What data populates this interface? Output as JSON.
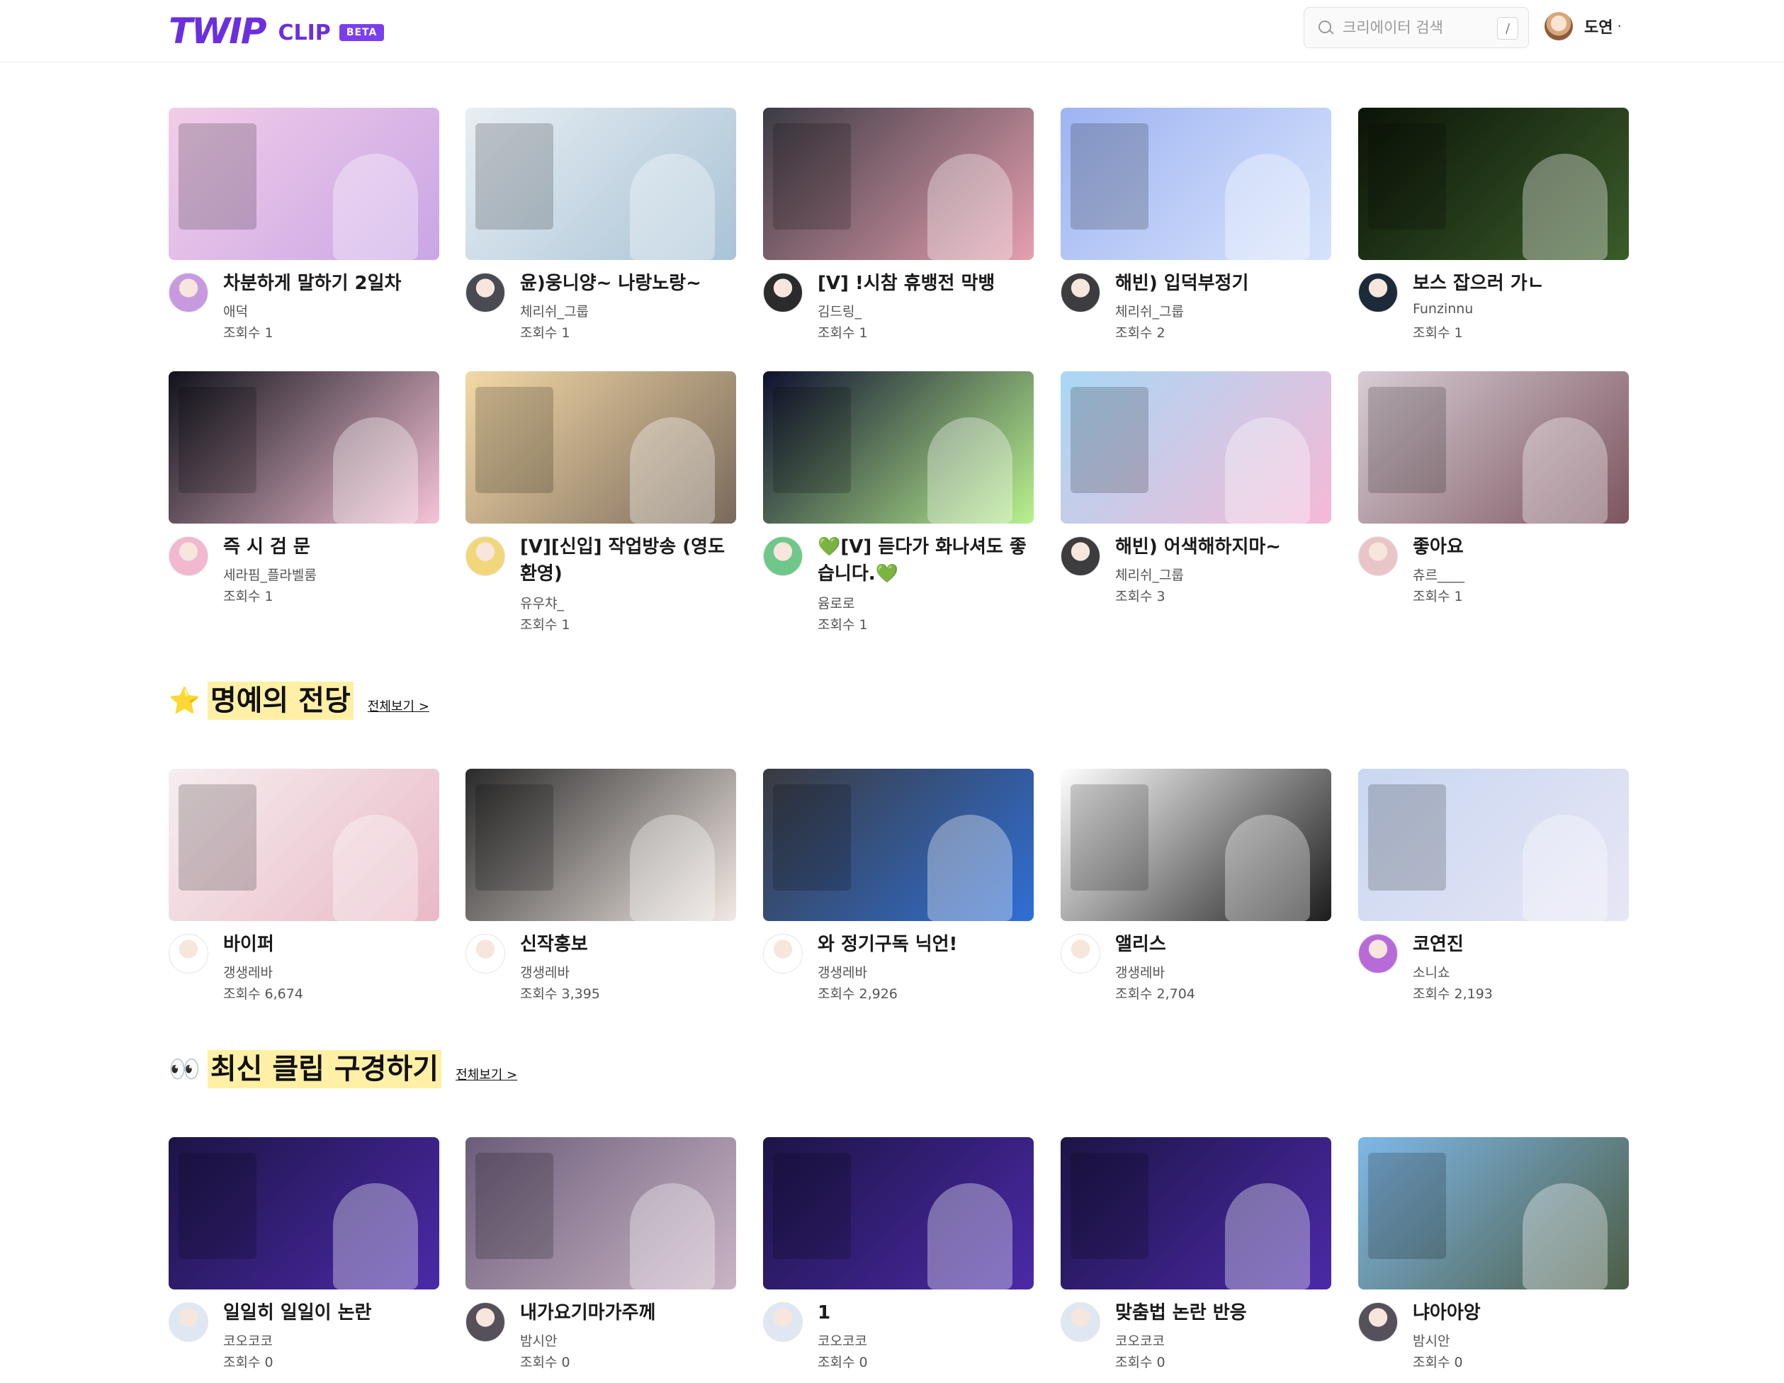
{
  "header": {
    "logo_main": "TWIP",
    "logo_sub": "CLIP",
    "logo_badge": "BETA",
    "search_placeholder": "크리에이터 검색",
    "search_shortcut": "/",
    "user_name": "도연",
    "user_caret": "·",
    "brand_color": "#6b2fe0"
  },
  "top_clips": [
    {
      "title": "차분하게 말하기 2일차",
      "channel": "애덕",
      "views": "조회수 1",
      "thumb_colors": [
        "#f2cde8",
        "#c9a6e6"
      ],
      "avatar_color": "#c79ae0"
    },
    {
      "title": "윤)웅니양~ 나랑노랑~",
      "channel": "체리쉬_그룹",
      "views": "조회수 1",
      "thumb_colors": [
        "#e8eef3",
        "#a9c3d6"
      ],
      "avatar_color": "#4a4a52"
    },
    {
      "title": "[V] !시참 휴뱅전 막뱅",
      "channel": "김드링_",
      "views": "조회수 1",
      "thumb_colors": [
        "#3c3b44",
        "#e69fb0"
      ],
      "avatar_color": "#2b2b2b"
    },
    {
      "title": "해빈) 입덕부정기",
      "channel": "체리쉬_그룹",
      "views": "조회수 2",
      "thumb_colors": [
        "#9eb4f2",
        "#d7e3fb"
      ],
      "avatar_color": "#3d3d40"
    },
    {
      "title": "보스 잡으러 가ㄴ",
      "channel": "Funzinnu",
      "views": "조회수 1",
      "thumb_colors": [
        "#0b1408",
        "#3b5c2a"
      ],
      "avatar_color": "#1c2a3a"
    },
    {
      "title": "즉 시 검 문",
      "channel": "세라핌_플라벨룸",
      "views": "조회수 1",
      "thumb_colors": [
        "#10121a",
        "#f7c4d8"
      ],
      "avatar_color": "#f2b8cf"
    },
    {
      "title": "[V][신입] 작업방송 (영도환영)",
      "channel": "유우챠_",
      "views": "조회수 1",
      "thumb_colors": [
        "#f3d9a6",
        "#7a6a5c"
      ],
      "avatar_color": "#f2d77a"
    },
    {
      "title": "💚[V] 듣다가 화나셔도 좋습니다.💚",
      "channel": "윰로로",
      "views": "조회수 1",
      "thumb_colors": [
        "#0f1030",
        "#b9f28f"
      ],
      "avatar_color": "#6fc88a"
    },
    {
      "title": "해빈) 어색해하지마~",
      "channel": "체리쉬_그룹",
      "views": "조회수 3",
      "thumb_colors": [
        "#a8d8f5",
        "#f6b9d6"
      ],
      "avatar_color": "#3d3d40"
    },
    {
      "title": "좋아요",
      "channel": "츄르____",
      "views": "조회수 1",
      "thumb_colors": [
        "#d8cdd4",
        "#7c5560"
      ],
      "avatar_color": "#e9c4c8"
    }
  ],
  "hall_of_fame": {
    "emoji": "⭐",
    "title": "명예의 전당",
    "more": "전체보기 >",
    "clips": [
      {
        "title": "바이퍼",
        "channel": "갱생레바",
        "views": "조회수 6,674",
        "thumb_colors": [
          "#f6eef0",
          "#e9b9c7"
        ],
        "avatar_color": "#ffffff"
      },
      {
        "title": "신작홍보",
        "channel": "갱생레바",
        "views": "조회수 3,395",
        "thumb_colors": [
          "#2a2a2a",
          "#f3e9e4"
        ],
        "avatar_color": "#ffffff"
      },
      {
        "title": "와 정기구독 닉언!",
        "channel": "갱생레바",
        "views": "조회수 2,926",
        "thumb_colors": [
          "#3a3a3f",
          "#2f6fd6"
        ],
        "avatar_color": "#ffffff"
      },
      {
        "title": "앨리스",
        "channel": "갱생레바",
        "views": "조회수 2,704",
        "thumb_colors": [
          "#ffffff",
          "#1c1c1c"
        ],
        "avatar_color": "#ffffff"
      },
      {
        "title": "코연진",
        "channel": "소니쇼",
        "views": "조회수 2,193",
        "thumb_colors": [
          "#c9d7f2",
          "#e7e6f4"
        ],
        "avatar_color": "#b86bd8"
      }
    ]
  },
  "latest": {
    "emoji": "👀",
    "title": "최신 클립 구경하기",
    "more": "전체보기 >",
    "clips": [
      {
        "title": "일일히 일일이 논란",
        "channel": "코오코코",
        "views": "조회수 0",
        "thumb_colors": [
          "#1d1446",
          "#4b2aa8"
        ],
        "avatar_color": "#dfe8f2"
      },
      {
        "title": "내가요기마가주께",
        "channel": "밤시안",
        "views": "조회수 0",
        "thumb_colors": [
          "#6b5d7a",
          "#c9b4c4"
        ],
        "avatar_color": "#555059"
      },
      {
        "title": "1",
        "channel": "코오코코",
        "views": "조회수 0",
        "thumb_colors": [
          "#1d1446",
          "#4b2aa8"
        ],
        "avatar_color": "#dfe8f2"
      },
      {
        "title": "맞춤법 논란 반응",
        "channel": "코오코코",
        "views": "조회수 0",
        "thumb_colors": [
          "#1d1446",
          "#4b2aa8"
        ],
        "avatar_color": "#dfe8f2"
      },
      {
        "title": "냐아아앙",
        "channel": "밤시안",
        "views": "조회수 0",
        "thumb_colors": [
          "#7fb8e8",
          "#4c5d45"
        ],
        "avatar_color": "#555059"
      }
    ]
  }
}
